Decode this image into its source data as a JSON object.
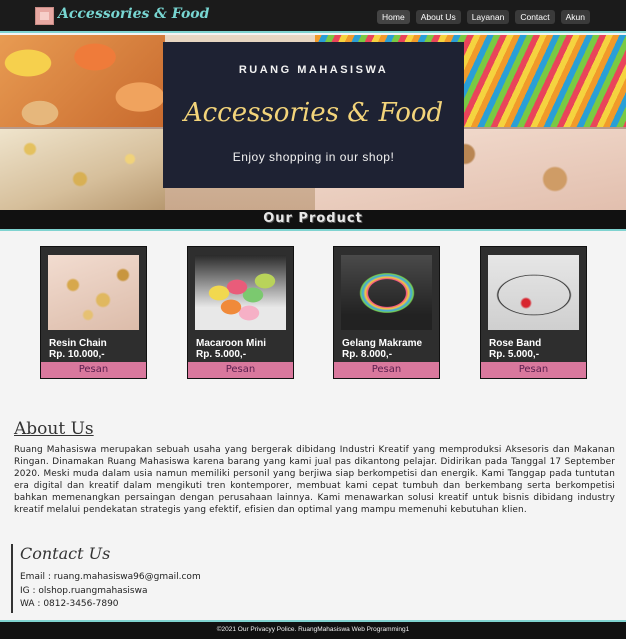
{
  "header": {
    "brand": "Accessories & Food",
    "logo_icon": "image-icon",
    "nav": [
      "Home",
      "About Us",
      "Layanan",
      "Contact",
      "Akun"
    ],
    "accent_color": "#78d6d2"
  },
  "hero": {
    "eyebrow": "RUANG MAHASISWA",
    "title": "Accessories & Food",
    "subtitle": "Enjoy shopping in our shop!"
  },
  "products": {
    "title": "Our Product",
    "items": [
      {
        "name": "Resin Chain",
        "price": "Rp. 10.000,-",
        "button": "Pesan"
      },
      {
        "name": "Macaroon Mini",
        "price": "Rp. 5.000,-",
        "button": "Pesan"
      },
      {
        "name": "Gelang Makrame",
        "price": "Rp. 8.000,-",
        "button": "Pesan"
      },
      {
        "name": "Rose Band",
        "price": "Rp. 5.000,-",
        "button": "Pesan"
      }
    ]
  },
  "about": {
    "title": "About Us",
    "text": "Ruang Mahasiswa merupakan sebuah usaha yang bergerak dibidang Industri Kreatif yang memproduksi Aksesoris dan Makanan Ringan. Dinamakan Ruang Mahasiswa karena barang yang kami jual pas dikantong pelajar. Didirikan pada Tanggal 17 September 2020. Meski muda dalam usia namun memiliki personil yang berjiwa siap berkompetisi dan energik. Kami Tanggap pada tuntutan era digital dan kreatif dalam mengikuti tren kontemporer, membuat kami cepat tumbuh dan berkembang serta berkompetisi bahkan memenangkan persaingan dengan perusahaan lainnya. Kami menawarkan solusi kreatif untuk bisnis dibidang industry kreatif melalui pendekatan strategis yang efektif, efisien dan optimal yang mampu memenuhi kebutuhan klien."
  },
  "contact": {
    "title": "Contact Us",
    "email": "Email : ruang.mahasiswa96@gmail.com",
    "ig": "IG : olshop.ruangmahasiswa",
    "wa": "WA : 0812-3456-7890"
  },
  "footer": {
    "text": "©2021 Our Privacyy Police. RuangMahasiswa Web Programming1"
  }
}
